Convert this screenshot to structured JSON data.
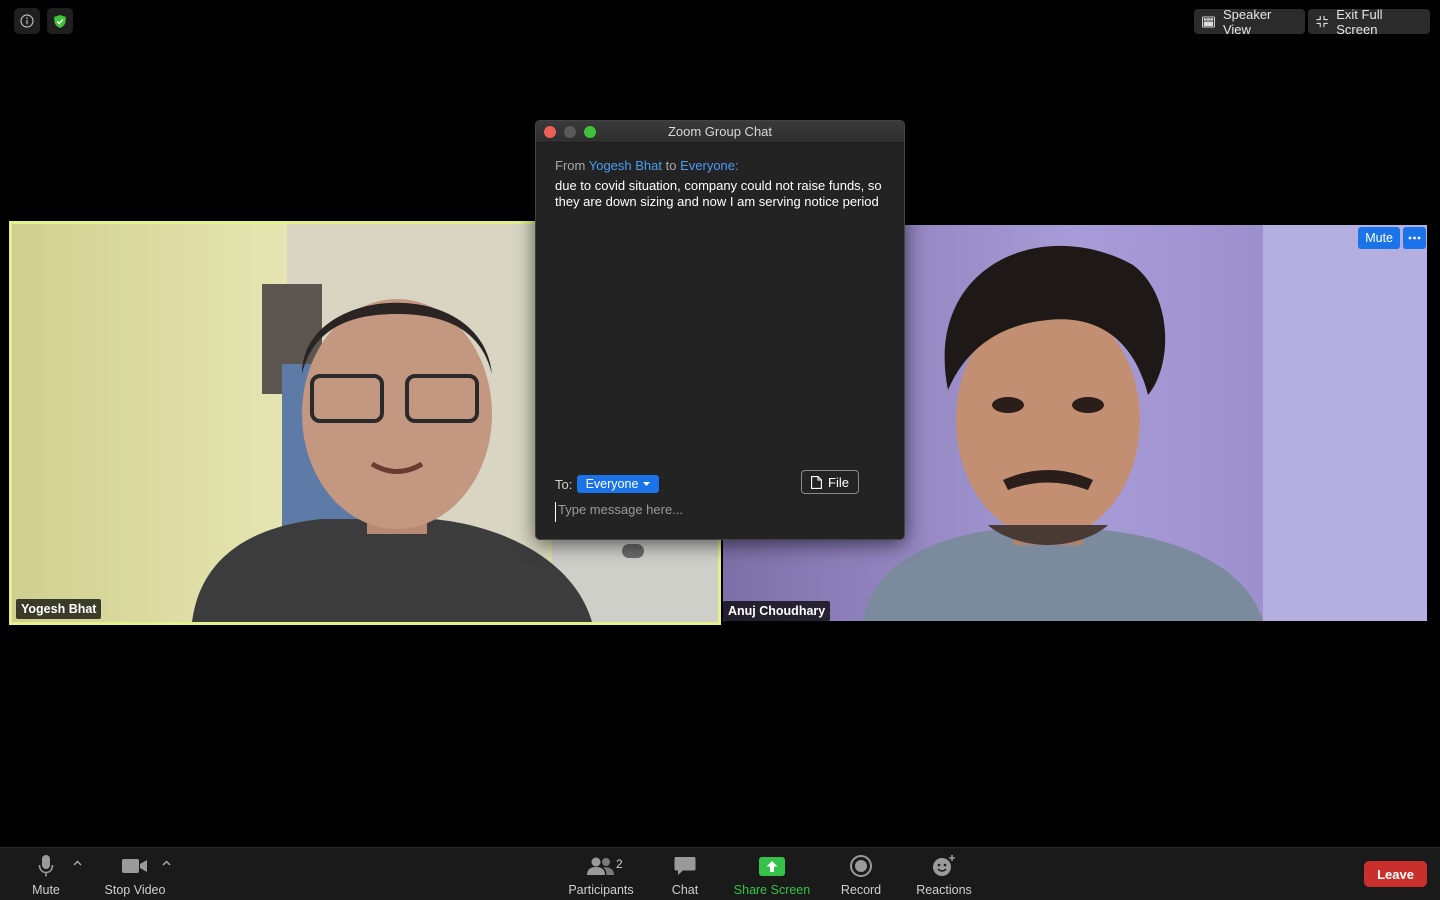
{
  "top_bar": {
    "info_icon": "info-icon",
    "security_icon": "shield-check-icon",
    "speaker_view_label": "Speaker View",
    "exit_fullscreen_label": "Exit Full Screen"
  },
  "participants": [
    {
      "name": "Yogesh Bhat",
      "active_speaker": true
    },
    {
      "name": "Anuj Choudhary",
      "active_speaker": false,
      "mute_label": "Mute"
    }
  ],
  "chat": {
    "title": "Zoom Group Chat",
    "from_prefix": "From",
    "sender": "Yogesh Bhat",
    "to_word": "to",
    "recipient": "Everyone:",
    "message": "due to covid situation, company could not raise funds, so they are down sizing and now I am serving notice period",
    "to_label": "To:",
    "to_recipient": "Everyone",
    "file_label": "File",
    "input_placeholder": "Type message here..."
  },
  "toolbar": {
    "mute_label": "Mute",
    "stop_video_label": "Stop Video",
    "participants_label": "Participants",
    "participants_count": "2",
    "chat_label": "Chat",
    "share_label": "Share Screen",
    "record_label": "Record",
    "reactions_label": "Reactions",
    "leave_label": "Leave"
  },
  "colors": {
    "accent_blue": "#1a73e8",
    "active_speaker_border": "#e6f08a",
    "share_green": "#36c248",
    "leave_red": "#c9302c"
  }
}
